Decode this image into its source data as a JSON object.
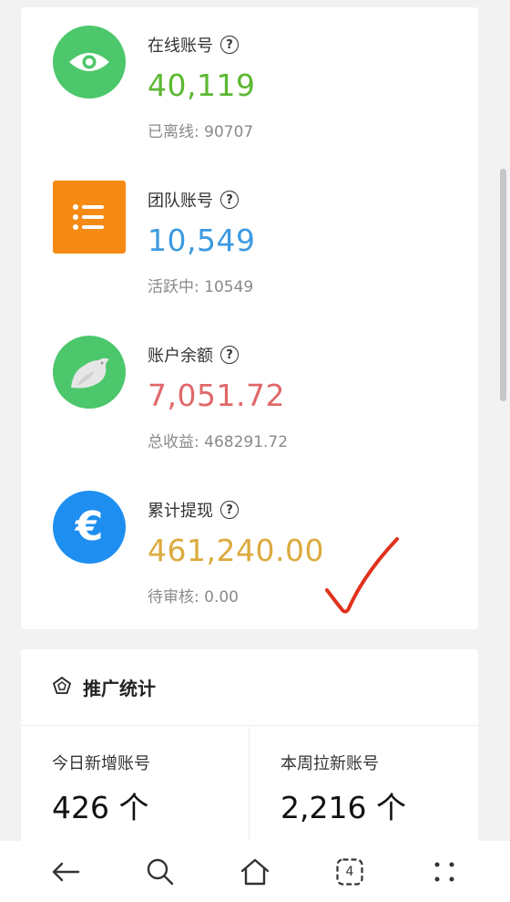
{
  "stats": [
    {
      "title": "在线账号",
      "value": "40,119",
      "sub": "已离线: 90707",
      "icon": "eye-icon",
      "icon_bg": "#4cc76b",
      "value_color": "#5cb832"
    },
    {
      "title": "团队账号",
      "value": "10,549",
      "sub": "活跃中: 10549",
      "icon": "list-icon",
      "icon_bg": "#f58a14",
      "value_color": "#3c9ae0"
    },
    {
      "title": "账户余额",
      "value": "7,051.72",
      "sub": "总收益: 468291.72",
      "icon": "bird-icon",
      "icon_bg": "#4cc76b",
      "value_color": "#e0686a"
    },
    {
      "title": "累计提现",
      "value": "461,240.00",
      "sub": "待审核: 0.00",
      "icon": "euro-icon",
      "icon_bg": "#1e8ff0",
      "value_color": "#dcaa3e"
    }
  ],
  "promo": {
    "title": "推广统计",
    "today_label": "今日新增账号",
    "today_value": "426 个",
    "week_label": "本周拉新账号",
    "week_value": "2,216 个"
  },
  "nav": {
    "tab_count": "4"
  },
  "colors": {
    "checkmark": "#e0321e"
  }
}
